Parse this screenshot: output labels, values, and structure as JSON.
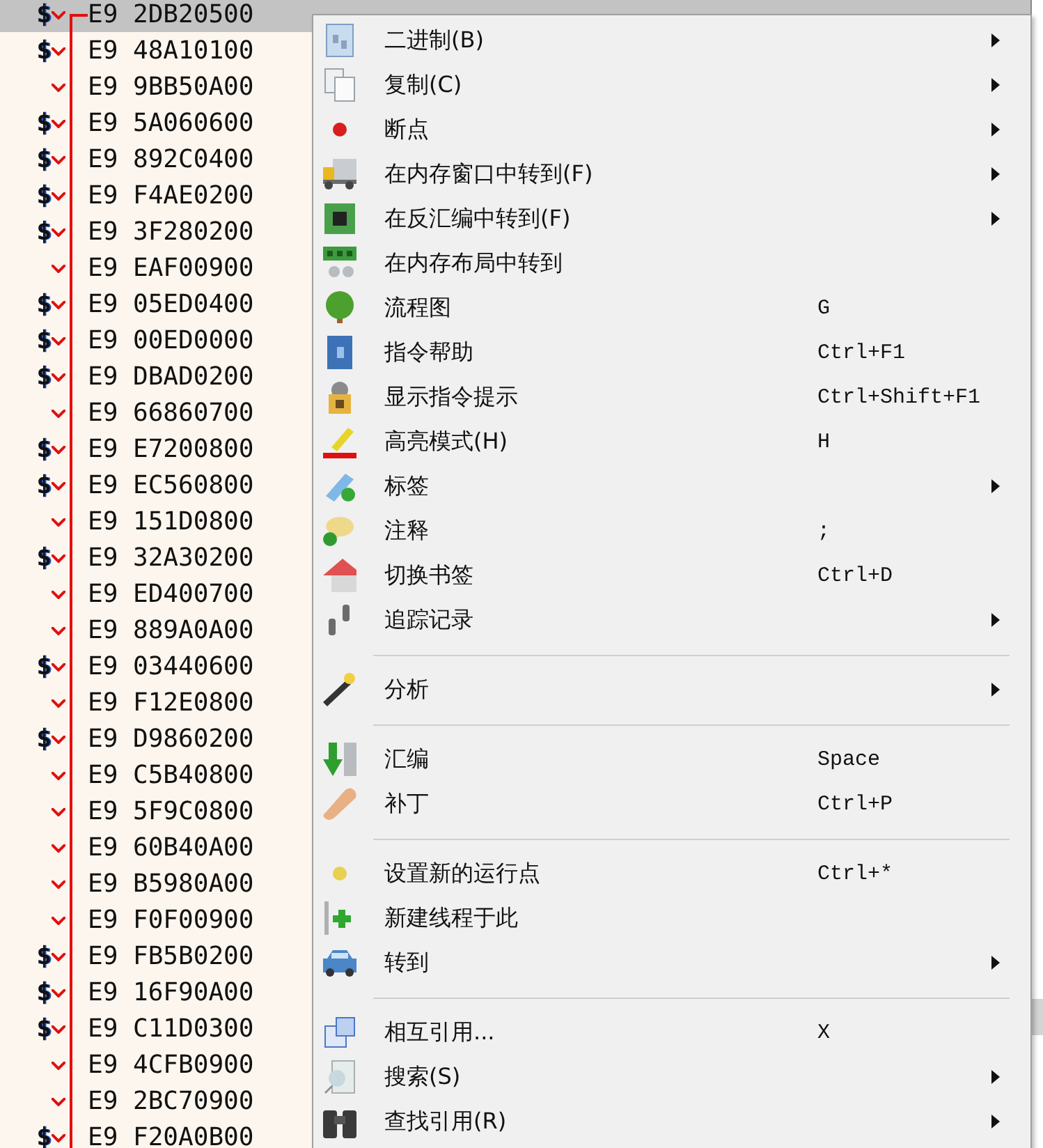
{
  "disassembly": {
    "rows": [
      {
        "marker": "$",
        "bytes": "E9 2DB20500",
        "selected": true
      },
      {
        "marker": "$",
        "bytes": "E9 48A10100",
        "selected": false
      },
      {
        "bytes": "E9 9BB50A00",
        "selected": false
      },
      {
        "marker": "$",
        "bytes": "E9 5A060600",
        "selected": false
      },
      {
        "marker": "$",
        "bytes": "E9 892C0400",
        "selected": false
      },
      {
        "marker": "$",
        "bytes": "E9 F4AE0200",
        "selected": false
      },
      {
        "marker": "$",
        "bytes": "E9 3F280200",
        "selected": false
      },
      {
        "bytes": "E9 EAF00900",
        "selected": false
      },
      {
        "marker": "$",
        "bytes": "E9 05ED0400",
        "selected": false
      },
      {
        "marker": "$",
        "bytes": "E9 00ED0000",
        "selected": false
      },
      {
        "marker": "$",
        "bytes": "E9 DBAD0200",
        "selected": false
      },
      {
        "bytes": "E9 66860700",
        "selected": false
      },
      {
        "marker": "$",
        "bytes": "E9 E7200800",
        "selected": false
      },
      {
        "marker": "$",
        "bytes": "E9 EC560800",
        "selected": false
      },
      {
        "bytes": "E9 151D0800",
        "selected": false
      },
      {
        "marker": "$",
        "bytes": "E9 32A30200",
        "selected": false
      },
      {
        "bytes": "E9 ED400700",
        "selected": false
      },
      {
        "bytes": "E9 889A0A00",
        "selected": false
      },
      {
        "marker": "$",
        "bytes": "E9 03440600",
        "selected": false
      },
      {
        "bytes": "E9 F12E0800",
        "selected": false
      },
      {
        "marker": "$",
        "bytes": "E9 D9860200",
        "selected": false
      },
      {
        "bytes": "E9 C5B40800",
        "selected": false
      },
      {
        "bytes": "E9 5F9C0800",
        "selected": false
      },
      {
        "bytes": "E9 60B40A00",
        "selected": false
      },
      {
        "bytes": "E9 B5980A00",
        "selected": false
      },
      {
        "bytes": "E9 F0F00900",
        "selected": false
      },
      {
        "marker": "$",
        "bytes": "E9 FB5B0200",
        "selected": false
      },
      {
        "marker": "$",
        "bytes": "E9 16F90A00",
        "selected": false
      },
      {
        "marker": "$",
        "bytes": "E9 C11D0300",
        "selected": false
      },
      {
        "bytes": "E9 4CFB0900",
        "selected": false
      },
      {
        "bytes": "E9 2BC70900",
        "selected": false
      },
      {
        "marker": "$",
        "bytes": "E9 F20A0B00",
        "selected": false
      }
    ]
  },
  "context_menu": {
    "items": [
      {
        "kind": "item",
        "label": "二进制(B)",
        "submenu": true
      },
      {
        "kind": "item",
        "label": "复制(C)",
        "submenu": true
      },
      {
        "kind": "item",
        "label": "断点",
        "submenu": true
      },
      {
        "kind": "item",
        "label": "在内存窗口中转到(F)",
        "submenu": true
      },
      {
        "kind": "item",
        "label": "在反汇编中转到(F)",
        "submenu": true
      },
      {
        "kind": "item",
        "label": "在内存布局中转到",
        "submenu": false
      },
      {
        "kind": "item",
        "label": "流程图",
        "shortcut": "G",
        "submenu": false
      },
      {
        "kind": "item",
        "label": "指令帮助",
        "shortcut": "Ctrl+F1",
        "submenu": false
      },
      {
        "kind": "item",
        "label": "显示指令提示",
        "shortcut": "Ctrl+Shift+F1",
        "submenu": false
      },
      {
        "kind": "item",
        "label": "高亮模式(H)",
        "shortcut": "H",
        "submenu": false
      },
      {
        "kind": "item",
        "label": "标签",
        "submenu": true
      },
      {
        "kind": "item",
        "label": "注释",
        "shortcut": ";",
        "submenu": false
      },
      {
        "kind": "item",
        "label": "切换书签",
        "shortcut": "Ctrl+D",
        "submenu": false
      },
      {
        "kind": "item",
        "label": "追踪记录",
        "submenu": true
      },
      {
        "kind": "separator"
      },
      {
        "kind": "item",
        "label": "分析",
        "submenu": true
      },
      {
        "kind": "separator"
      },
      {
        "kind": "item",
        "label": "汇编",
        "shortcut": "Space",
        "submenu": false
      },
      {
        "kind": "item",
        "label": "补丁",
        "shortcut": "Ctrl+P",
        "submenu": false
      },
      {
        "kind": "separator"
      },
      {
        "kind": "item",
        "label": "设置新的运行点",
        "shortcut": "Ctrl+*",
        "submenu": false
      },
      {
        "kind": "item",
        "label": "新建线程于此",
        "submenu": false
      },
      {
        "kind": "item",
        "label": "转到",
        "submenu": true
      },
      {
        "kind": "separator"
      },
      {
        "kind": "item",
        "label": "相互引用...",
        "shortcut": "X",
        "submenu": false
      },
      {
        "kind": "item",
        "label": "搜索(S)",
        "submenu": true
      },
      {
        "kind": "item",
        "label": "查找引用(R)",
        "submenu": true
      }
    ]
  }
}
